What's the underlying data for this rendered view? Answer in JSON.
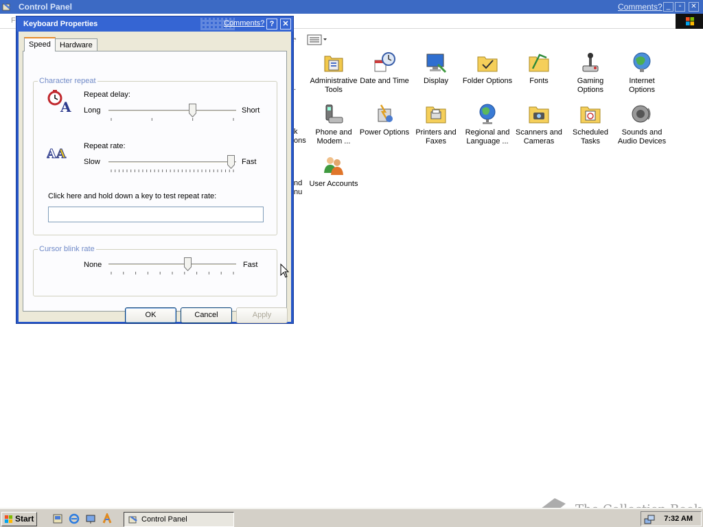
{
  "control_panel": {
    "title": "Control Panel",
    "comments_link": "Comments?",
    "menu_first": "F",
    "window_controls": [
      "_",
      "▫",
      "✕"
    ]
  },
  "items": [
    {
      "label": "Administrative Tools",
      "icon": "administrative-tools-icon"
    },
    {
      "label": "Date and Time",
      "icon": "date-time-icon"
    },
    {
      "label": "Display",
      "icon": "display-icon"
    },
    {
      "label": "Folder Options",
      "icon": "folder-options-icon"
    },
    {
      "label": "Fonts",
      "icon": "fonts-icon"
    },
    {
      "label": "Gaming Options",
      "icon": "gaming-options-icon"
    },
    {
      "label": "Internet Options",
      "icon": "internet-options-icon"
    },
    {
      "label": "Phone and Modem ...",
      "icon": "phone-modem-icon"
    },
    {
      "label": "Power Options",
      "icon": "power-options-icon"
    },
    {
      "label": "Printers and Faxes",
      "icon": "printers-faxes-icon"
    },
    {
      "label": "Regional and Language ...",
      "icon": "regional-language-icon"
    },
    {
      "label": "Scanners and Cameras",
      "icon": "scanners-cameras-icon"
    },
    {
      "label": "Scheduled Tasks",
      "icon": "scheduled-tasks-icon"
    },
    {
      "label": "Sounds and Audio Devices",
      "icon": "sounds-audio-icon"
    },
    {
      "label": "User Accounts",
      "icon": "user-accounts-icon"
    }
  ],
  "clipped_labels": {
    "left_col_1": ".",
    "left_col_2a": "k",
    "left_col_2b": "ons",
    "left_col_3a": "nd",
    "left_col_3b": "nu"
  },
  "dialog": {
    "title": "Keyboard Properties",
    "comments_link": "Comments?",
    "help_button": "?",
    "close_button": "✕",
    "tabs": {
      "speed": "Speed",
      "hardware": "Hardware"
    },
    "character_repeat": {
      "legend": "Character repeat",
      "repeat_delay": {
        "label": "Repeat delay:",
        "min_label": "Long",
        "max_label": "Short",
        "value": 0.67
      },
      "repeat_rate": {
        "label": "Repeat rate:",
        "min_label": "Slow",
        "max_label": "Fast",
        "value": 1.0
      },
      "test_label": "Click here and hold down a key to test repeat rate:",
      "test_value": ""
    },
    "cursor_blink": {
      "legend": "Cursor blink rate",
      "min_label": "None",
      "max_label": "Fast",
      "value": 0.63
    },
    "buttons": {
      "ok": "OK",
      "cancel": "Cancel",
      "apply": "Apply"
    }
  },
  "taskbar": {
    "start_label": "Start",
    "task_label": "Control Panel",
    "clock": "7:32 AM"
  },
  "watermark": "The Collection Book"
}
